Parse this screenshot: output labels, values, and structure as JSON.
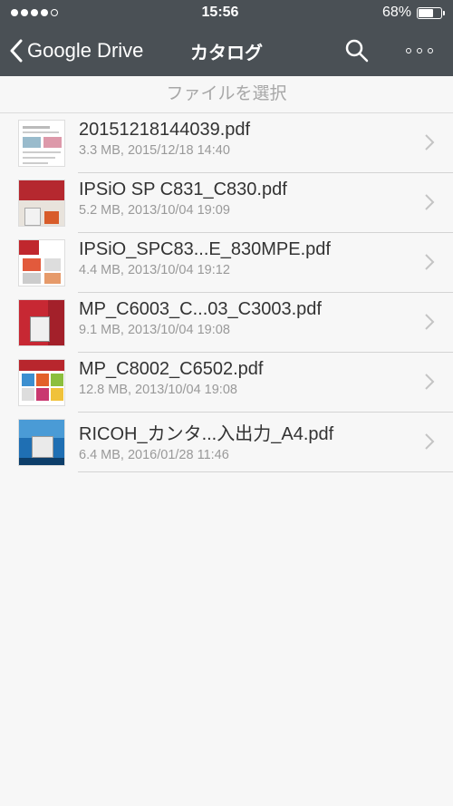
{
  "status": {
    "time": "15:56",
    "battery": "68%",
    "battery_level": 0.68
  },
  "nav": {
    "back_label": "Google Drive",
    "title": "カタログ"
  },
  "subheader": "ファイルを選択",
  "files": [
    {
      "name": "20151218144039.pdf",
      "meta": "3.3 MB, 2015/12/18 14:40"
    },
    {
      "name": "IPSiO SP C831_C830.pdf",
      "meta": "5.2 MB, 2013/10/04 19:09"
    },
    {
      "name": "IPSiO_SPC83...E_830MPE.pdf",
      "meta": "4.4 MB, 2013/10/04 19:12"
    },
    {
      "name": "MP_C6003_C...03_C3003.pdf",
      "meta": "9.1 MB, 2013/10/04 19:08"
    },
    {
      "name": "MP_C8002_C6502.pdf",
      "meta": "12.8 MB, 2013/10/04 19:08"
    },
    {
      "name": "RICOH_カンタ...入出力_A4.pdf",
      "meta": "6.4 MB, 2016/01/28 11:46"
    }
  ],
  "colors": {
    "nav_bg": "#4a5055",
    "list_bg": "#f7f7f7"
  }
}
